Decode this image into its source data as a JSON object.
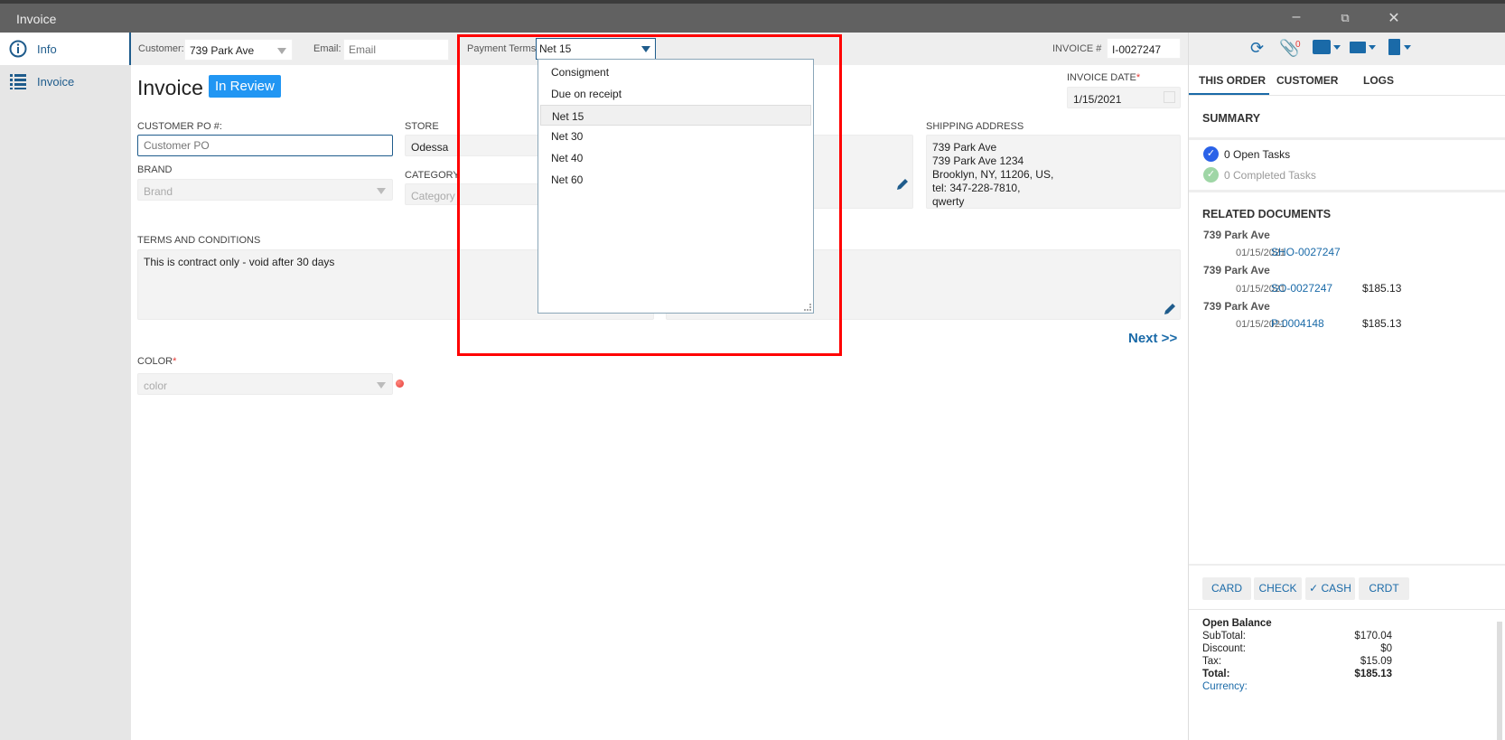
{
  "window": {
    "title": "Invoice"
  },
  "sidebar": {
    "items": [
      {
        "label": "Info",
        "icon": "info-icon"
      },
      {
        "label": "Invoice",
        "icon": "list-icon"
      }
    ]
  },
  "toolbar": {
    "customer_label": "Customer:",
    "customer_value": "739 Park Ave",
    "email_label": "Email:",
    "email_placeholder": "Email",
    "payment_terms_label": "Payment Terms:",
    "payment_terms_value": "Net 15",
    "invoice_no_label": "INVOICE #",
    "invoice_no_value": "I-0027247",
    "attachment_count": "0"
  },
  "payment_terms_options": [
    "Consigment",
    "Due on receipt",
    "Net 15",
    "Net 30",
    "Net 40",
    "Net 60"
  ],
  "form": {
    "title": "Invoice",
    "status": "In Review",
    "invoice_date_label": "INVOICE DATE",
    "invoice_date": "1/15/2021",
    "customer_po_label": "CUSTOMER PO #:",
    "customer_po_placeholder": "Customer PO",
    "store_label": "STORE",
    "store_value": "Odessa",
    "brand_label": "BRAND",
    "brand_placeholder": "Brand",
    "category_label": "CATEGORY",
    "category_placeholder": "Category",
    "shipping_label": "SHIPPING ADDRESS",
    "shipping_lines": [
      "739 Park Ave",
      "739 Park Ave 1234",
      "Brooklyn, NY, 11206, US,",
      "tel: 347-228-7810,",
      "qwerty"
    ],
    "terms_label": "TERMS AND CONDITIONS",
    "terms_value": "This is contract only - void after 30 days",
    "next": "Next >>",
    "color_label": "COLOR",
    "color_placeholder": "color"
  },
  "right": {
    "tabs": [
      "THIS ORDER",
      "CUSTOMER",
      "LOGS"
    ],
    "summary_title": "SUMMARY",
    "open_tasks": "0 Open Tasks",
    "completed_tasks": "0 Completed Tasks",
    "related_title": "RELATED DOCUMENTS",
    "documents": [
      {
        "name": "739 Park Ave",
        "date": "01/15/2021",
        "id": "SHO-0027247",
        "amount": ""
      },
      {
        "name": "739 Park Ave",
        "date": "01/15/2021",
        "id": "SO-0027247",
        "amount": "$185.13"
      },
      {
        "name": "739 Park Ave",
        "date": "01/15/2021",
        "id": "P-0004148",
        "amount": "$185.13"
      }
    ],
    "payment_buttons": [
      "CARD",
      "CHECK",
      "CASH",
      "CRDT"
    ],
    "balance": {
      "title": "Open Balance",
      "subtotal_label": "SubTotal:",
      "subtotal": "$170.04",
      "discount_label": "Discount:",
      "discount": "$0",
      "tax_label": "Tax:",
      "tax": "$15.09",
      "total_label": "Total:",
      "total": "$185.13",
      "currency_label": "Currency:"
    }
  }
}
